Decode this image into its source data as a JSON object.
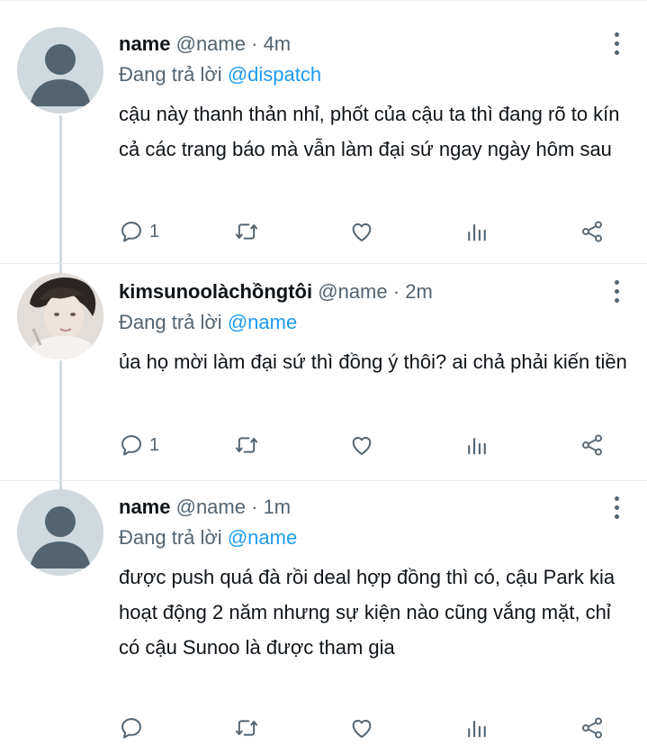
{
  "replying_prefix": "Đang trả lời",
  "tweets": [
    {
      "display_name": "name",
      "handle": "@name",
      "dot": "·",
      "time": "4m",
      "replying_to": "@dispatch",
      "text": "cậu này thanh thản nhỉ, phốt của cậu ta thì đang rõ to kín cả các trang báo mà vẫn làm đại sứ ngay ngày hôm sau",
      "avatar": "default-avatar",
      "reply_count": "1"
    },
    {
      "display_name": "kimsunoolàchồngtôi",
      "handle": "@name",
      "dot": "·",
      "time": "2m",
      "replying_to": "@name",
      "text": "ủa họ mời làm đại sứ thì đồng ý thôi? ai chả phải kiến tiền",
      "avatar": "user-photo",
      "reply_count": "1"
    },
    {
      "display_name": "name",
      "handle": "@name",
      "dot": "·",
      "time": "1m",
      "replying_to": "@name",
      "text": "được push quá đà rồi deal hợp đồng thì có, cậu Park kia hoạt động 2 năm nhưng sự kiện nào cũng vắng mặt, chỉ có cậu Sunoo là được tham gia",
      "avatar": "default-avatar",
      "reply_count": ""
    }
  ],
  "icons": {
    "reply": "reply-icon",
    "retweet": "retweet-icon",
    "like": "heart-icon",
    "analytics": "analytics-icon",
    "share": "share-icon",
    "more": "more-vertical-icon"
  },
  "colors": {
    "link": "#1d9bf0",
    "secondary_text": "#536471",
    "primary_text": "#0f1419",
    "thread_line": "#cfd9de",
    "default_avatar": "#cfd9de"
  }
}
